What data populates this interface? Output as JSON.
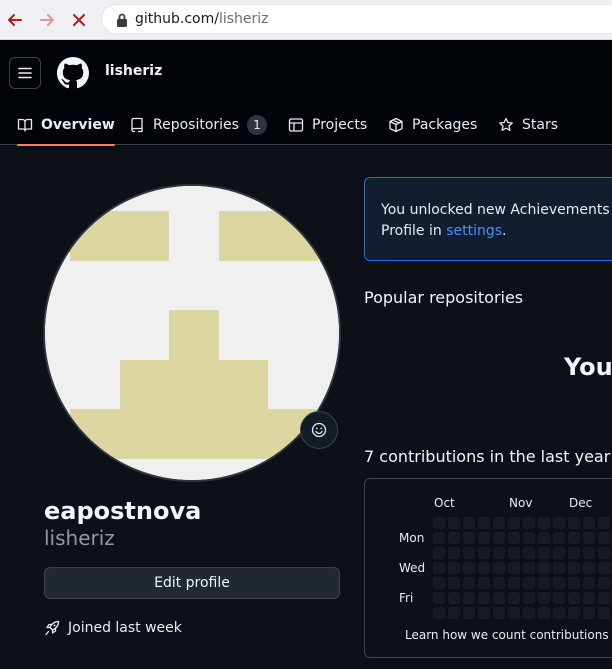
{
  "browser": {
    "url_host": "github.com/",
    "url_path": "lisheriz",
    "icons": [
      "back-arrow-icon",
      "forward-arrow-icon",
      "stop-loading-icon",
      "lock-icon"
    ]
  },
  "header": {
    "username": "lisheriz",
    "icons": [
      "hamburger-menu-icon",
      "github-logo-icon"
    ]
  },
  "tabs": [
    {
      "label": "Overview",
      "icon": "book-icon",
      "active": true
    },
    {
      "label": "Repositories",
      "icon": "repo-icon",
      "count": "1"
    },
    {
      "label": "Projects",
      "icon": "table-icon"
    },
    {
      "label": "Packages",
      "icon": "package-icon"
    },
    {
      "label": "Stars",
      "icon": "star-icon"
    }
  ],
  "profile": {
    "display_name": "eapostnova",
    "login": "lisheriz",
    "edit_label": "Edit profile",
    "joined_label": "Joined last week",
    "avatar_colors": {
      "background": "#f0f0f0",
      "pattern": "#dcd6a0"
    }
  },
  "flash": {
    "text_line1": "You unlocked new Achievements wi",
    "text_line2_prefix": "Profile in ",
    "link": "settings",
    "text_line2_suffix": "."
  },
  "popular": {
    "heading": "Popular repositories",
    "empty_text": "You"
  },
  "contributions": {
    "heading": "7 contributions in the last year",
    "months": [
      "Oct",
      "Nov",
      "Dec"
    ],
    "days": [
      "Mon",
      "Wed",
      "Fri"
    ],
    "footer": "Learn how we count contributions"
  },
  "colors": {
    "page_bg": "#0d1117",
    "header_bg": "#010409",
    "tab_underline": "#f78166",
    "flash_border": "#1f6feb",
    "link": "#4493f8"
  }
}
